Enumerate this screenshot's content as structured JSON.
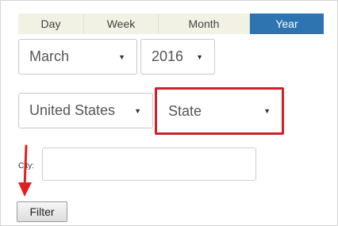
{
  "tabs": [
    {
      "label": "Day",
      "active": false
    },
    {
      "label": "Week",
      "active": false
    },
    {
      "label": "Month",
      "active": false
    },
    {
      "label": "Year",
      "active": true
    }
  ],
  "filters": {
    "month": "March",
    "year": "2016",
    "country": "United States",
    "state": "State",
    "city_label": "City:",
    "city_value": "",
    "filter_button": "Filter"
  },
  "colors": {
    "active_tab": "#2e74b1",
    "highlight": "#d0202a",
    "annotation_arrow": "#e02020"
  }
}
